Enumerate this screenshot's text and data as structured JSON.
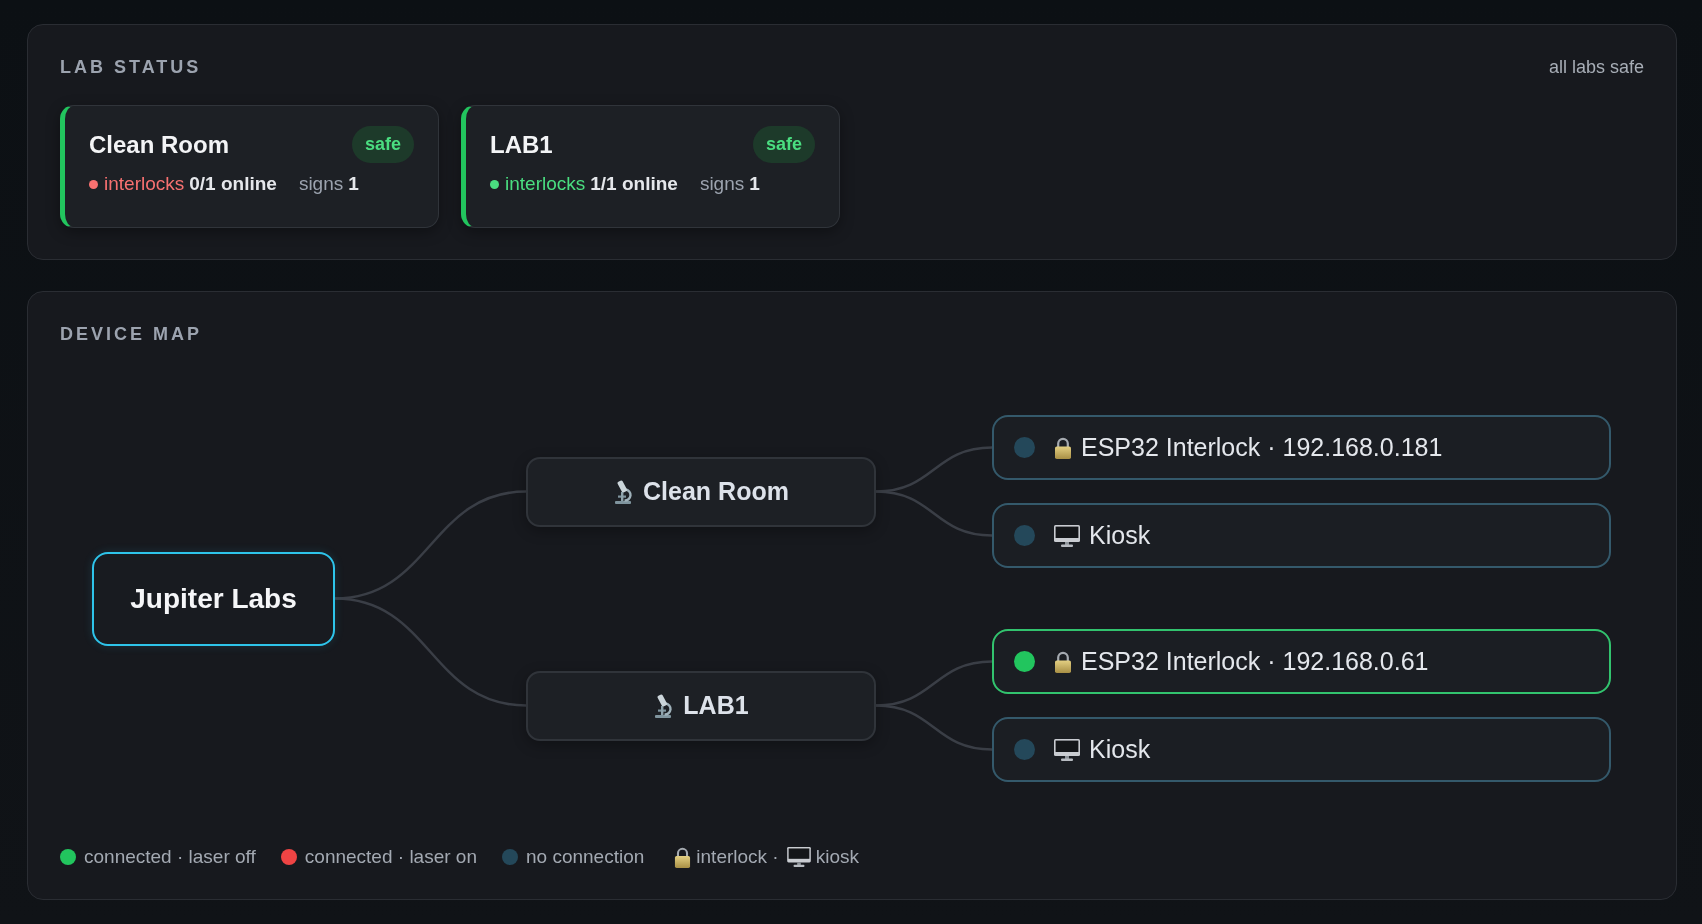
{
  "lab_status": {
    "title": "LAB STATUS",
    "summary": "all labs safe",
    "labs": [
      {
        "name": "Clean Room",
        "badge": "safe",
        "safe": true,
        "color": "#f87171",
        "interlocks_label": "interlocks",
        "interlocks_value": "0/1 online",
        "signs_label": "signs",
        "signs_value": "1"
      },
      {
        "name": "LAB1",
        "badge": "safe",
        "safe": true,
        "color": "#4ade80",
        "interlocks_label": "interlocks",
        "interlocks_value": "1/1 online",
        "signs_label": "signs",
        "signs_value": "1"
      }
    ]
  },
  "device_map": {
    "title": "DEVICE MAP",
    "root": {
      "label": "Jupiter Labs",
      "children": [
        {
          "label": "Clean Room",
          "children": [
            {
              "kind": "interlock",
              "label": "ESP32 Interlock · 192.168.0.181",
              "color": "#24485a"
            },
            {
              "kind": "kiosk",
              "label": "Kiosk",
              "color": "#24485a"
            }
          ]
        },
        {
          "label": "LAB1",
          "children": [
            {
              "kind": "interlock",
              "label": "ESP32 Interlock · 192.168.0.61",
              "color": "#22c55e"
            },
            {
              "kind": "kiosk",
              "label": "Kiosk",
              "color": "#24485a"
            }
          ]
        }
      ]
    },
    "legend": [
      {
        "kind": "dot",
        "color": "#22c55e",
        "label": "connected · laser off"
      },
      {
        "kind": "dot",
        "color": "#ef4444",
        "label": "connected · laser on"
      },
      {
        "kind": "dot",
        "color": "#24485a",
        "label": "no connection"
      },
      {
        "kind": "interlock",
        "label": "interlock ·"
      },
      {
        "kind": "kiosk",
        "label": "kiosk"
      }
    ]
  }
}
